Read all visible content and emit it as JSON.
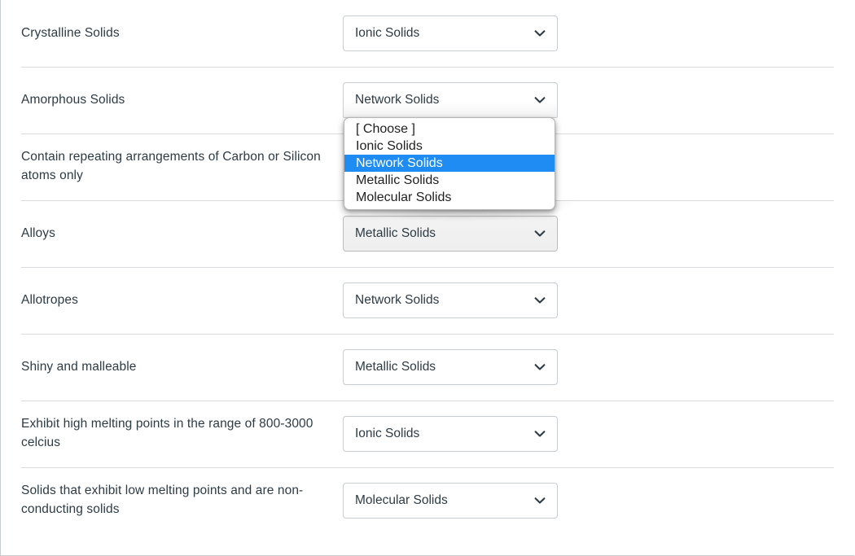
{
  "question": {
    "type": "matching",
    "rows": [
      {
        "prompt": "Crystalline Solids",
        "selected": "Ionic Solids",
        "state": "closed"
      },
      {
        "prompt": "Amorphous Solids",
        "selected": "Network Solids",
        "state": "open"
      },
      {
        "prompt": "Contain repeating arrangements of Carbon or Silicon atoms only",
        "selected": "",
        "state": "covered"
      },
      {
        "prompt": "Alloys",
        "selected": "Metallic Solids",
        "state": "shadowed"
      },
      {
        "prompt": "Allotropes",
        "selected": "Network Solids",
        "state": "closed"
      },
      {
        "prompt": "Shiny and malleable",
        "selected": "Metallic Solids",
        "state": "closed"
      },
      {
        "prompt": "Exhibit high melting points in the range of 800-3000 celcius",
        "selected": "Ionic Solids",
        "state": "closed"
      },
      {
        "prompt": "Solids that exhibit low melting points and are non-conducting solids",
        "selected": "Molecular Solids",
        "state": "closed"
      }
    ],
    "options": [
      {
        "label": "[ Choose ]",
        "selected": false
      },
      {
        "label": "Ionic Solids",
        "selected": false
      },
      {
        "label": "Network Solids",
        "selected": true
      },
      {
        "label": "Metallic Solids",
        "selected": false
      },
      {
        "label": "Molecular Solids",
        "selected": false
      }
    ],
    "open_row_index": 1,
    "icons": {
      "dropdown": "chevron-down-icon"
    },
    "colors": {
      "text": "#2d3b45",
      "divider": "#d8dade",
      "select_border": "#c7cdd1",
      "option_highlight": "#1f8cf3",
      "option_highlight_text": "#ffffff",
      "frame_border": "#c7cdd1"
    }
  }
}
